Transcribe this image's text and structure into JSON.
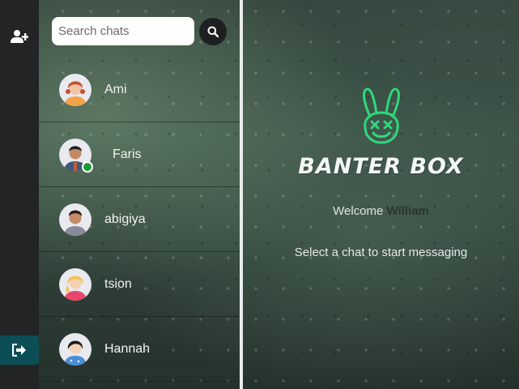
{
  "sidebar": {
    "add_user_icon": "user-plus-icon",
    "logout_icon": "sign-out-icon",
    "logout_color": "#0c4e55"
  },
  "search": {
    "placeholder": "Search chats",
    "button_icon": "search-icon"
  },
  "chats": [
    {
      "name": "Ami",
      "online": false
    },
    {
      "name": "Faris",
      "online": true
    },
    {
      "name": "abigiya",
      "online": false
    },
    {
      "name": "tsion",
      "online": false
    },
    {
      "name": "Hannah",
      "online": false
    }
  ],
  "main": {
    "brand": "BANTER BOX",
    "logo_icon": "bunny-logo-icon",
    "logo_color": "#2fd87a",
    "welcome_label": "Welcome",
    "username": "William",
    "hint": "Select a chat to start messaging"
  }
}
